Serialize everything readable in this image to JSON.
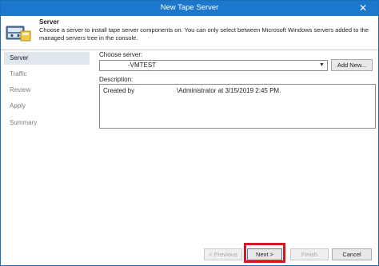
{
  "window": {
    "title": "New Tape Server",
    "close_glyph": "✕"
  },
  "header": {
    "title": "Server",
    "description": "Choose a server to install tape server components on. You can only select between Microsoft Windows servers added to the managed servers tree in the console.",
    "icon": "tape-server-wizard-icon"
  },
  "steps": [
    "Server",
    "Traffic",
    "Review",
    "Apply",
    "Summary"
  ],
  "active_step": "Server",
  "form": {
    "choose_server_label": "Choose server:",
    "server_value": "-VMTEST",
    "add_new_label": "Add New...",
    "description_label": "Description:",
    "description_created_by": "Created by",
    "description_admin": "\\Administrator at 3/15/2019 2:45 PM."
  },
  "footer": {
    "previous_label": "< Previous",
    "next_label": "Next >",
    "finish_label": "Finish",
    "cancel_label": "Cancel"
  },
  "colors": {
    "titlebar": "#1b78cc",
    "active_step": "#dfe6ee",
    "highlight": "#d31a23"
  }
}
